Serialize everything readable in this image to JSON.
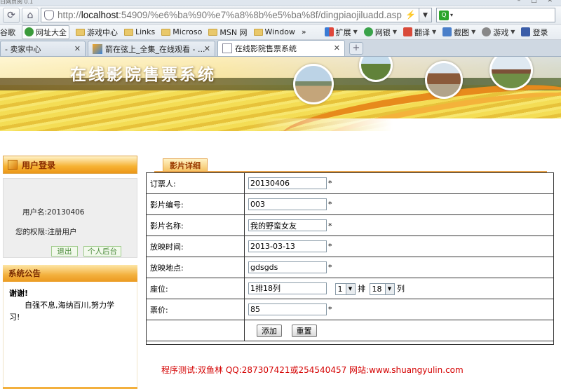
{
  "window": {
    "title_fragment": "日网页阅 0.1"
  },
  "address_bar": {
    "url_prefix": "http://",
    "url_host": "localhost",
    "url_rest": ":54909/%e6%ba%90%e7%a8%8b%e5%ba%8f/dingpiaojiluadd.asp"
  },
  "bookmarks": [
    "谷歌",
    "网址大全",
    "游戏中心",
    "Links",
    "Microso",
    "MSN 网",
    "Window",
    "»"
  ],
  "bookmark_tools": [
    "扩展",
    "网银",
    "翻译",
    "截图",
    "游戏",
    "登录"
  ],
  "tabs": [
    {
      "label": "- 卖家中心"
    },
    {
      "label": "箭在弦上_全集_在线观看 - ..."
    },
    {
      "label": "在线影院售票系统"
    }
  ],
  "banner": {
    "title": "在线影院售票系统"
  },
  "login_panel": {
    "heading": "用户登录",
    "username_line": "用户名:20130406",
    "role_line": "您的权限:注册用户",
    "logout_label": "退出",
    "backend_label": "个人后台"
  },
  "notice_panel": {
    "heading": "系统公告",
    "line1": "谢谢!",
    "line2": "自强不息,海纳百川,努力学",
    "line3": "习!"
  },
  "content_tab": {
    "label": "影片详细"
  },
  "form": {
    "rows": [
      {
        "label": "订票人:",
        "value": "20130406",
        "required": "*"
      },
      {
        "label": "影片编号:",
        "value": "003",
        "required": "*"
      },
      {
        "label": "影片名称:",
        "value": "我的野蛮女友",
        "required": "*"
      },
      {
        "label": "放映时间:",
        "value": "2013-03-13",
        "required": "*"
      },
      {
        "label": "放映地点:",
        "value": "gdsgds",
        "required": "*"
      }
    ],
    "seat": {
      "label": "座位:",
      "value": "1排18列",
      "row_select": "1",
      "row_unit": "排",
      "col_select": "18",
      "col_unit": "列"
    },
    "price": {
      "label": "票价:",
      "value": "85",
      "required": "*"
    },
    "submit_label": "添加",
    "reset_label": "重置"
  },
  "footer": {
    "text": "程序测试:双鱼林 QQ:287307421或254540457 网站:www.shuangyulin.com"
  }
}
